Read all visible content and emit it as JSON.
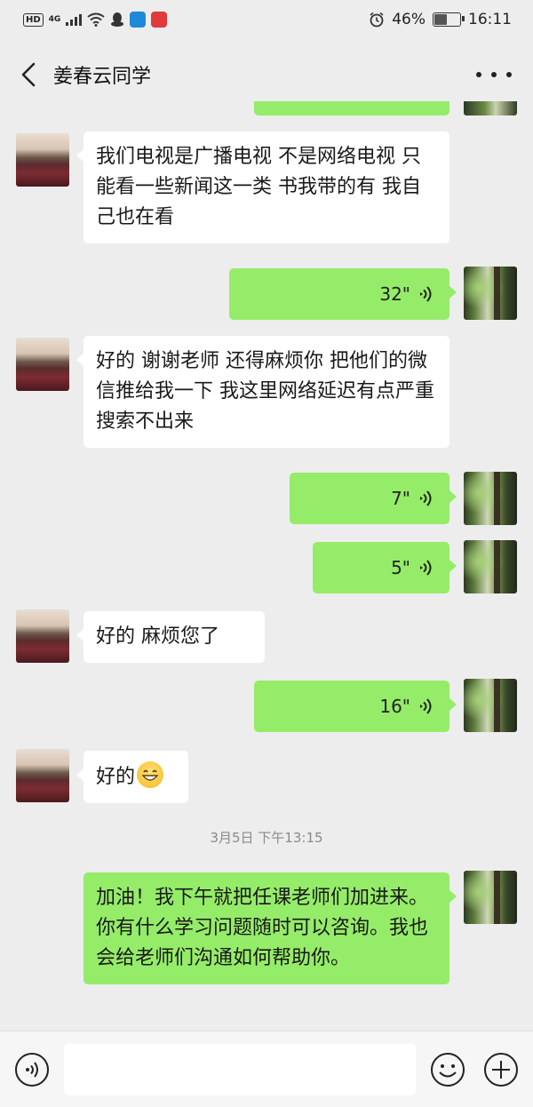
{
  "status_bar": {
    "hd_label": "HD",
    "network_label": "4G",
    "battery_percent": "46%",
    "battery_level": 0.46,
    "time": "16:11"
  },
  "header": {
    "title": "姜春云同学",
    "back_icon": "chevron-left-icon",
    "more_icon": "more-dots-icon"
  },
  "messages": [
    {
      "side": "in",
      "type": "text",
      "text": "我们电视是广播电视  不是网络电视  只能看一些新闻这一类  书我带的有 我自己也在看"
    },
    {
      "side": "out",
      "type": "voice",
      "duration": "32\""
    },
    {
      "side": "in",
      "type": "text",
      "text": "好的  谢谢老师  还得麻烦你 把他们的微信推给我一下  我这里网络延迟有点严重搜索不出来"
    },
    {
      "side": "out",
      "type": "voice",
      "duration": "7\""
    },
    {
      "side": "out",
      "type": "voice",
      "duration": "5\""
    },
    {
      "side": "in",
      "type": "text",
      "text": "好的  麻烦您了"
    },
    {
      "side": "out",
      "type": "voice",
      "duration": "16\""
    },
    {
      "side": "in",
      "type": "text",
      "text": "好的",
      "emoji": "grinning-face-emoji"
    },
    {
      "side": "out",
      "type": "text",
      "text": "加油！我下午就把任课老师们加进来。你有什么学习问题随时可以咨询。我也会给老师们沟通如何帮助你。"
    }
  ],
  "timestamp": "3月5日 下午13:15",
  "input_bar": {
    "placeholder": "",
    "voice_icon": "voice-toggle-icon",
    "emoji_icon": "emoji-smile-icon",
    "plus_icon": "plus-circle-icon"
  },
  "colors": {
    "background": "#ededed",
    "outgoing_bubble": "#95ec69",
    "incoming_bubble": "#ffffff"
  }
}
